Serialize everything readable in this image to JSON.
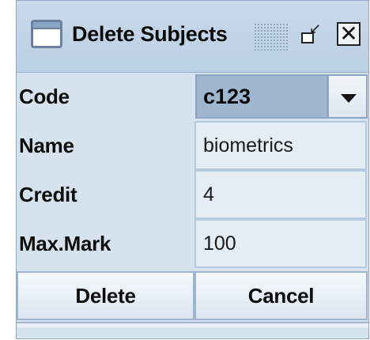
{
  "window": {
    "title": "Delete Subjects",
    "icons": [
      "window-app-icon",
      "iconify-icon",
      "close-icon"
    ]
  },
  "form": {
    "code": {
      "label": "Code",
      "value": "c123"
    },
    "name": {
      "label": "Name",
      "value": "biometrics"
    },
    "credit": {
      "label": "Credit",
      "value": "4"
    },
    "max_mark": {
      "label": "Max.Mark",
      "value": "100"
    }
  },
  "buttons": {
    "delete": "Delete",
    "cancel": "Cancel"
  },
  "colors": {
    "titlebar": "#c2d5e8",
    "field_bg": "#e4ecf4",
    "combo_selected_bg": "#9fb6cf",
    "border": "#9fb5cd"
  }
}
